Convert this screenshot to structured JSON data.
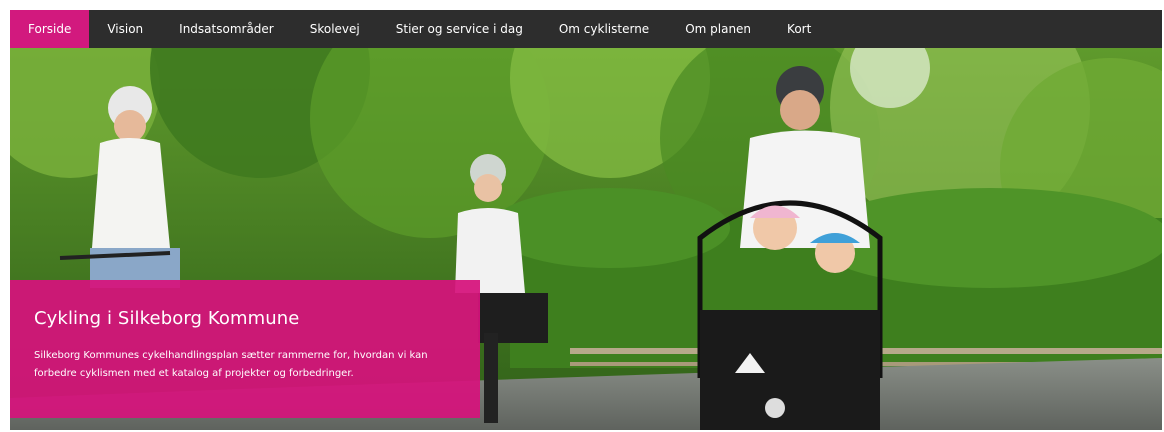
{
  "nav": {
    "items": [
      {
        "label": "Forside",
        "active": true
      },
      {
        "label": "Vision",
        "active": false
      },
      {
        "label": "Indsatsområder",
        "active": false
      },
      {
        "label": "Skolevej",
        "active": false
      },
      {
        "label": "Stier og service i dag",
        "active": false
      },
      {
        "label": "Om cyklisterne",
        "active": false
      },
      {
        "label": "Om planen",
        "active": false
      },
      {
        "label": "Kort",
        "active": false
      }
    ],
    "active_color": "#d2197e",
    "background_color": "#2d2d2d"
  },
  "hero": {
    "image_subject": "family-cycling-photo",
    "caption": {
      "title": "Cykling i Silkeborg Kommune",
      "text": "Silkeborg Kommunes cykelhandlingsplan sætter rammerne for, hvordan vi kan forbedre cyklismen med et katalog af projekter og forbedringer.",
      "background_color": "#d6127c"
    }
  }
}
